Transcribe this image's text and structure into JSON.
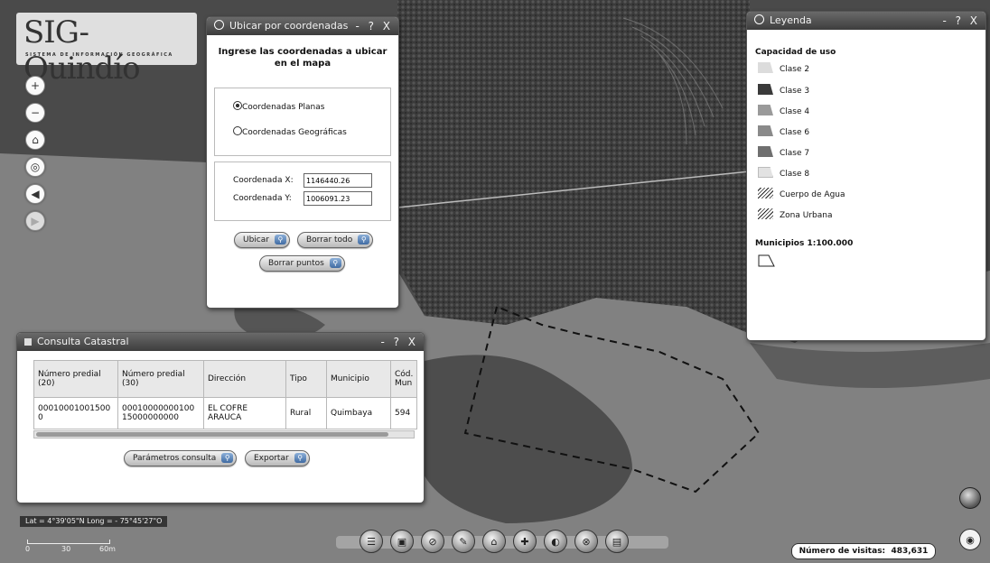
{
  "logo": {
    "title": "SIG-Quindío",
    "subtitle": "SISTEMA DE INFORMACIÓN GEOGRÁFICA"
  },
  "nav": [
    {
      "glyph": "+"
    },
    {
      "glyph": "−"
    },
    {
      "glyph": "⌂"
    },
    {
      "glyph": "◎"
    },
    {
      "glyph": "◀"
    },
    {
      "glyph": "▶"
    }
  ],
  "coords_window": {
    "title": "Ubicar por coordenadas",
    "controls": "- ? X",
    "heading": "Ingrese las coordenadas a ubicar en el mapa",
    "option_planas": "Coordenadas Planas",
    "option_geograficas": "Coordenadas Geográficas",
    "selected": "planas",
    "label_x": "Coordenada X:",
    "value_x": "1146440.26",
    "label_y": "Coordenada Y:",
    "value_y": "1006091.23",
    "btn_ubicar": "Ubicar",
    "btn_borrar_todo": "Borrar todo",
    "btn_borrar_puntos": "Borrar puntos"
  },
  "legend": {
    "title": "Leyenda",
    "controls": "- ? X",
    "section1": "Capacidad de uso",
    "items": [
      {
        "label": "Clase 2",
        "color": "#dcdcdc"
      },
      {
        "label": "Clase 3",
        "color": "#3a3a3a"
      },
      {
        "label": "Clase 4",
        "color": "#9a9a9a"
      },
      {
        "label": "Clase 6",
        "color": "#8a8a8a"
      },
      {
        "label": "Clase 7",
        "color": "#6f6f6f"
      },
      {
        "label": "Clase 8",
        "color": "#e2e2e2"
      },
      {
        "label": "Cuerpo de Agua",
        "color": "hatch"
      },
      {
        "label": "Zona Urbana",
        "color": "hatch"
      }
    ],
    "section2": "Municipios 1:100.000"
  },
  "catastral": {
    "title": "Consulta Catastral",
    "controls": "- ? X",
    "headers": [
      "Número predial (20)",
      "Número predial (30)",
      "Dirección",
      "Tipo",
      "Municipio",
      "Cód. Mun"
    ],
    "rows": [
      [
        "00010001001500 0",
        "00010000000100 15000000000",
        "EL COFRE ARAUCA",
        "Rural",
        "Quimbaya",
        "594"
      ]
    ],
    "btn_parametros": "Parámetros consulta",
    "btn_exportar": "Exportar"
  },
  "coords_readout": "Lat = 4°39'05\"N Long = - 75°45'27\"O",
  "scale": {
    "labels": [
      "0",
      "30",
      "60m"
    ]
  },
  "visits": {
    "label": "Número de visitas:",
    "value": "483,631"
  },
  "dock": [
    {
      "glyph": "☰"
    },
    {
      "glyph": "▣"
    },
    {
      "glyph": "⊘"
    },
    {
      "glyph": "✎"
    },
    {
      "glyph": "⌂"
    },
    {
      "glyph": "✚"
    },
    {
      "glyph": "◐"
    },
    {
      "glyph": "⊗"
    },
    {
      "glyph": "▤"
    }
  ],
  "colors": {
    "titlebar": "#4a4a4a",
    "accent_button": "#3f6ba3"
  }
}
